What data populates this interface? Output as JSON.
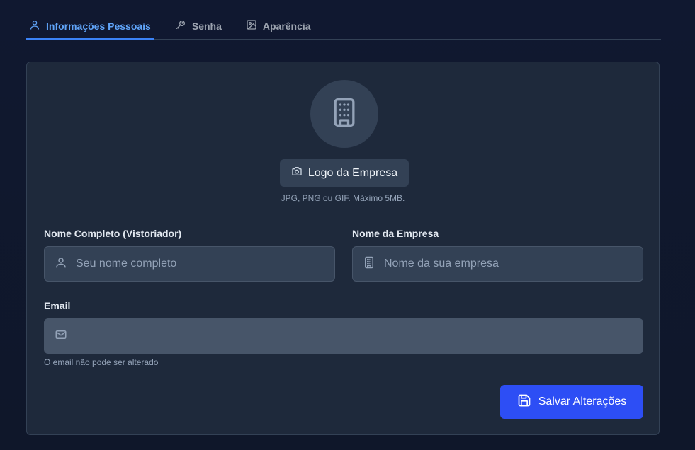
{
  "tabs": [
    {
      "label": "Informações Pessoais",
      "icon": "user-icon",
      "active": true
    },
    {
      "label": "Senha",
      "icon": "key-icon",
      "active": false
    },
    {
      "label": "Aparência",
      "icon": "image-icon",
      "active": false
    }
  ],
  "logo": {
    "button_label": "Logo da Empresa",
    "hint": "JPG, PNG ou GIF. Máximo 5MB."
  },
  "form": {
    "full_name": {
      "label": "Nome Completo (Vistoriador)",
      "placeholder": "Seu nome completo",
      "value": ""
    },
    "company_name": {
      "label": "Nome da Empresa",
      "placeholder": "Nome da sua empresa",
      "value": ""
    },
    "email": {
      "label": "Email",
      "value": "",
      "helper": "O email não pode ser alterado"
    }
  },
  "save_button": {
    "label": "Salvar Alterações"
  },
  "colors": {
    "background": "#0f172a",
    "card": "#1e293b",
    "accent": "#60a5fa",
    "primary_button": "#2d4ef5"
  }
}
